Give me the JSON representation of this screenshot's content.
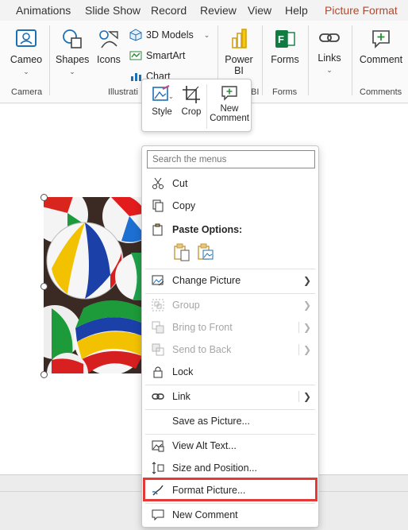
{
  "tabs": [
    "Animations",
    "Slide Show",
    "Record",
    "Review",
    "View",
    "Help",
    "Picture Format"
  ],
  "ribbon": {
    "cameo": "Cameo",
    "camera_group": "Camera",
    "shapes": "Shapes",
    "icons": "Icons",
    "models3d": "3D Models",
    "smartart": "SmartArt",
    "chart": "Chart",
    "illustrations_group": "Illustrati",
    "powerbi_line1": "Power",
    "powerbi_line2": "BI",
    "powerbi_group": "BI",
    "forms": "Forms",
    "forms_group": "Forms",
    "links": "Links",
    "comment": "Comment",
    "comments_group": "Comments"
  },
  "mini_toolbar": {
    "style": "Style",
    "crop": "Crop",
    "new_comment_line1": "New",
    "new_comment_line2": "Comment"
  },
  "context_menu": {
    "search_placeholder": "Search the menus",
    "cut": "Cut",
    "copy": "Copy",
    "paste_options": "Paste Options:",
    "change_picture": "Change Picture",
    "group": "Group",
    "bring_to_front": "Bring to Front",
    "send_to_back": "Send to Back",
    "lock": "Lock",
    "link": "Link",
    "save_as_picture": "Save as Picture...",
    "view_alt_text": "View Alt Text...",
    "size_and_position": "Size and Position...",
    "format_picture": "Format Picture...",
    "new_comment": "New Comment"
  },
  "colors": {
    "accent_tab": "#b7472a",
    "highlight": "#e53935",
    "disabled_text": "#a6a6a6"
  }
}
